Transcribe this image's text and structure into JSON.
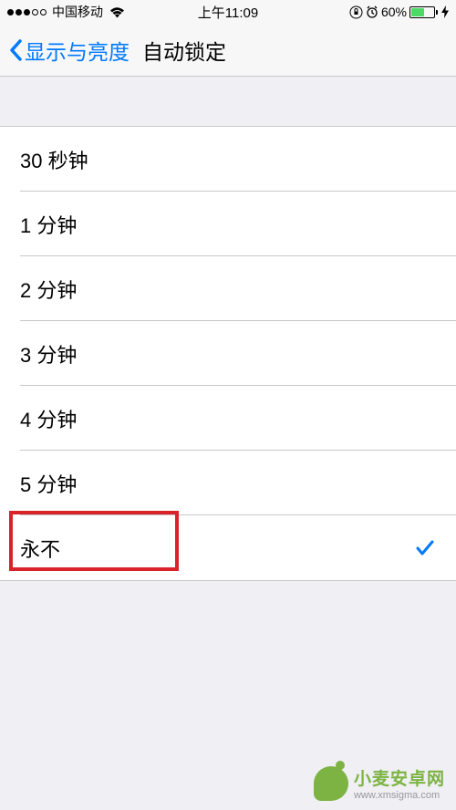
{
  "status": {
    "carrier": "中国移动",
    "time": "上午11:09",
    "battery_pct": "60%"
  },
  "nav": {
    "back_label": "显示与亮度",
    "title": "自动锁定"
  },
  "options": [
    {
      "label": "30 秒钟",
      "selected": false
    },
    {
      "label": "1 分钟",
      "selected": false
    },
    {
      "label": "2 分钟",
      "selected": false
    },
    {
      "label": "3 分钟",
      "selected": false
    },
    {
      "label": "4 分钟",
      "selected": false
    },
    {
      "label": "5 分钟",
      "selected": false
    },
    {
      "label": "永不",
      "selected": true
    }
  ],
  "watermark": {
    "title": "小麦安卓网",
    "url": "www.xmsigma.com"
  }
}
